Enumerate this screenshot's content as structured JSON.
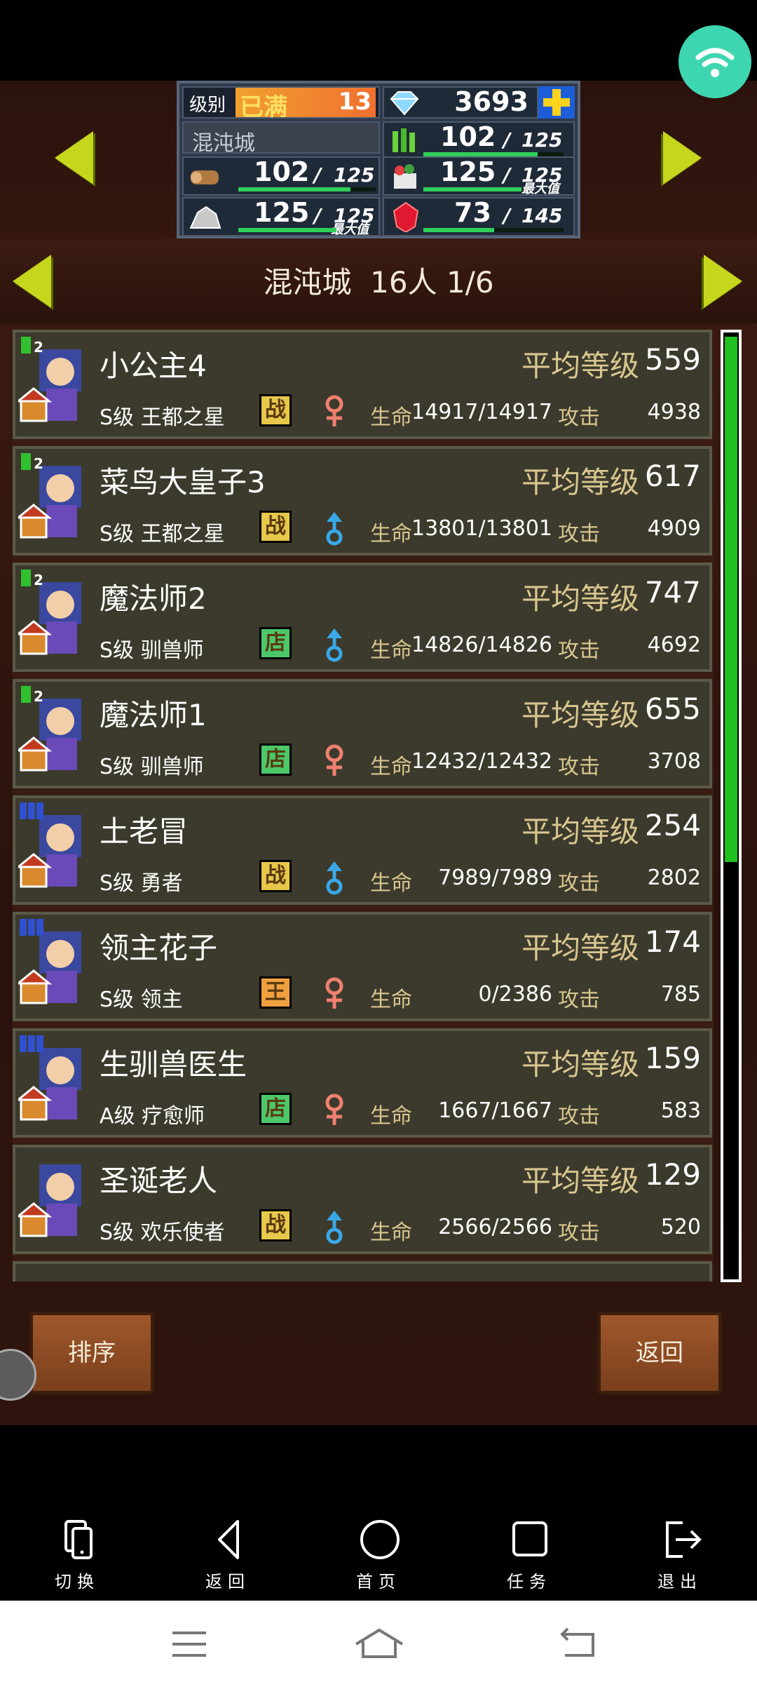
{
  "stats": {
    "level_label": "级别",
    "level_badge": "已满",
    "level_value": "13",
    "gems": "3693",
    "city_name": "混沌城",
    "crops": {
      "value": "102",
      "max": "125",
      "fill": 0.816
    },
    "wood": {
      "value": "102",
      "max": "125",
      "fill": 0.816
    },
    "food": {
      "value": "125",
      "max": "125",
      "max_tag": "最大值",
      "fill": 1.0
    },
    "ore": {
      "value": "125",
      "max": "125",
      "max_tag": "最大值",
      "fill": 1.0
    },
    "ruby": {
      "value": "73",
      "max": "145",
      "fill": 0.503
    }
  },
  "header": {
    "city": "混沌城",
    "count": "16人",
    "page": "1/6"
  },
  "labels": {
    "avg_level": "平均等级",
    "hp": "生命",
    "attack": "攻击"
  },
  "residents": [
    {
      "name": "小公主4",
      "level": "559",
      "job": "S级 王都之星",
      "role": "战",
      "role_color": "#e8c84a",
      "gender": "female",
      "hp": "14917/14917",
      "attack": "4938",
      "badge": "2",
      "badge_color": "green"
    },
    {
      "name": "菜鸟大皇子3",
      "level": "617",
      "job": "S级 王都之星",
      "role": "战",
      "role_color": "#e8c84a",
      "gender": "male",
      "hp": "13801/13801",
      "attack": "4909",
      "badge": "2",
      "badge_color": "green"
    },
    {
      "name": "魔法师2",
      "level": "747",
      "job": "S级 驯兽师",
      "role": "店",
      "role_color": "#4cc86a",
      "gender": "male",
      "hp": "14826/14826",
      "attack": "4692",
      "badge": "2",
      "badge_color": "green"
    },
    {
      "name": "魔法师1",
      "level": "655",
      "job": "S级 驯兽师",
      "role": "店",
      "role_color": "#4cc86a",
      "gender": "female",
      "hp": "12432/12432",
      "attack": "3708",
      "badge": "2",
      "badge_color": "green"
    },
    {
      "name": "土老冒",
      "level": "254",
      "job": "S级 勇者",
      "role": "战",
      "role_color": "#e8c84a",
      "gender": "male",
      "hp": "7989/7989",
      "attack": "2802",
      "badge": "",
      "badge_color": "blue"
    },
    {
      "name": "领主花子",
      "level": "174",
      "job": "S级 领主",
      "role": "王",
      "role_color": "#f0a040",
      "gender": "female",
      "hp": "0/2386",
      "attack": "785",
      "badge": "",
      "badge_color": "blue"
    },
    {
      "name": "生驯兽医生",
      "level": "159",
      "job": "A级 疗愈师",
      "role": "店",
      "role_color": "#4cc86a",
      "gender": "female",
      "hp": "1667/1667",
      "attack": "583",
      "badge": "",
      "badge_color": "blue"
    },
    {
      "name": "圣诞老人",
      "level": "129",
      "job": "S级 欢乐使者",
      "role": "战",
      "role_color": "#e8c84a",
      "gender": "male",
      "hp": "2566/2566",
      "attack": "520",
      "badge": "",
      "badge_color": "none"
    }
  ],
  "scroll": {
    "position": 0.0,
    "visible_fraction": 0.56
  },
  "buttons": {
    "sort": "排序",
    "back": "返回"
  },
  "phone_nav": [
    {
      "label": "切换",
      "icon": "switch-device-icon"
    },
    {
      "label": "返回",
      "icon": "back-triangle-icon"
    },
    {
      "label": "首页",
      "icon": "home-circle-icon"
    },
    {
      "label": "任务",
      "icon": "task-square-icon"
    },
    {
      "label": "退出",
      "icon": "exit-icon"
    }
  ],
  "colors": {
    "accent_green": "#2fd05a",
    "arrow_yellow": "#c6d61c",
    "wifi_bubble": "#3ed6b0",
    "label_gold": "#d8c690"
  }
}
